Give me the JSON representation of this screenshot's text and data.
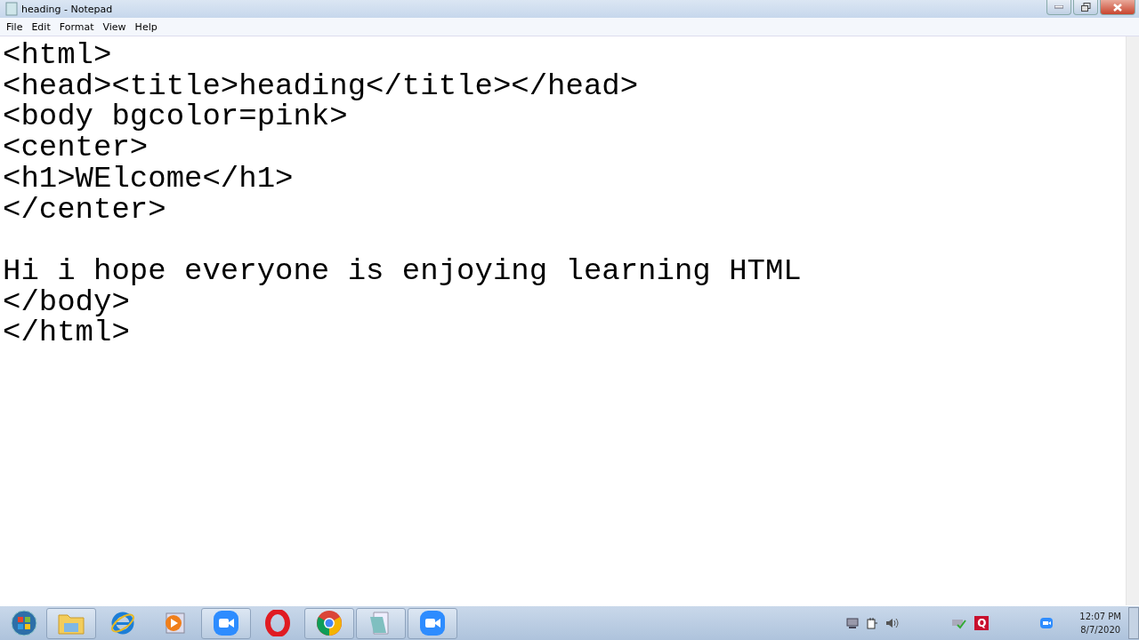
{
  "window": {
    "title": "heading - Notepad"
  },
  "menu": [
    "File",
    "Edit",
    "Format",
    "View",
    "Help"
  ],
  "editor": {
    "paragraphs": [
      [
        "<html>",
        "<head><title>heading</title></head>",
        "<body bgcolor=pink>",
        "<center>",
        "<h1>WElcome</h1>",
        "</center>"
      ],
      [
        "Hi i hope everyone is enjoying learning HTML",
        "</body>",
        "</html>"
      ]
    ]
  },
  "taskbar": {
    "apps": [
      {
        "kind": "folder",
        "open": true
      },
      {
        "kind": "ie",
        "open": false
      },
      {
        "kind": "media",
        "open": false
      },
      {
        "kind": "zoom",
        "open": true
      },
      {
        "kind": "opera",
        "open": false
      },
      {
        "kind": "chrome",
        "open": true
      },
      {
        "kind": "notepad",
        "open": true
      },
      {
        "kind": "zoom",
        "open": true
      }
    ],
    "tray": {
      "app_letter": "Q",
      "time": "12:07 PM",
      "date": "8/7/2020"
    }
  }
}
